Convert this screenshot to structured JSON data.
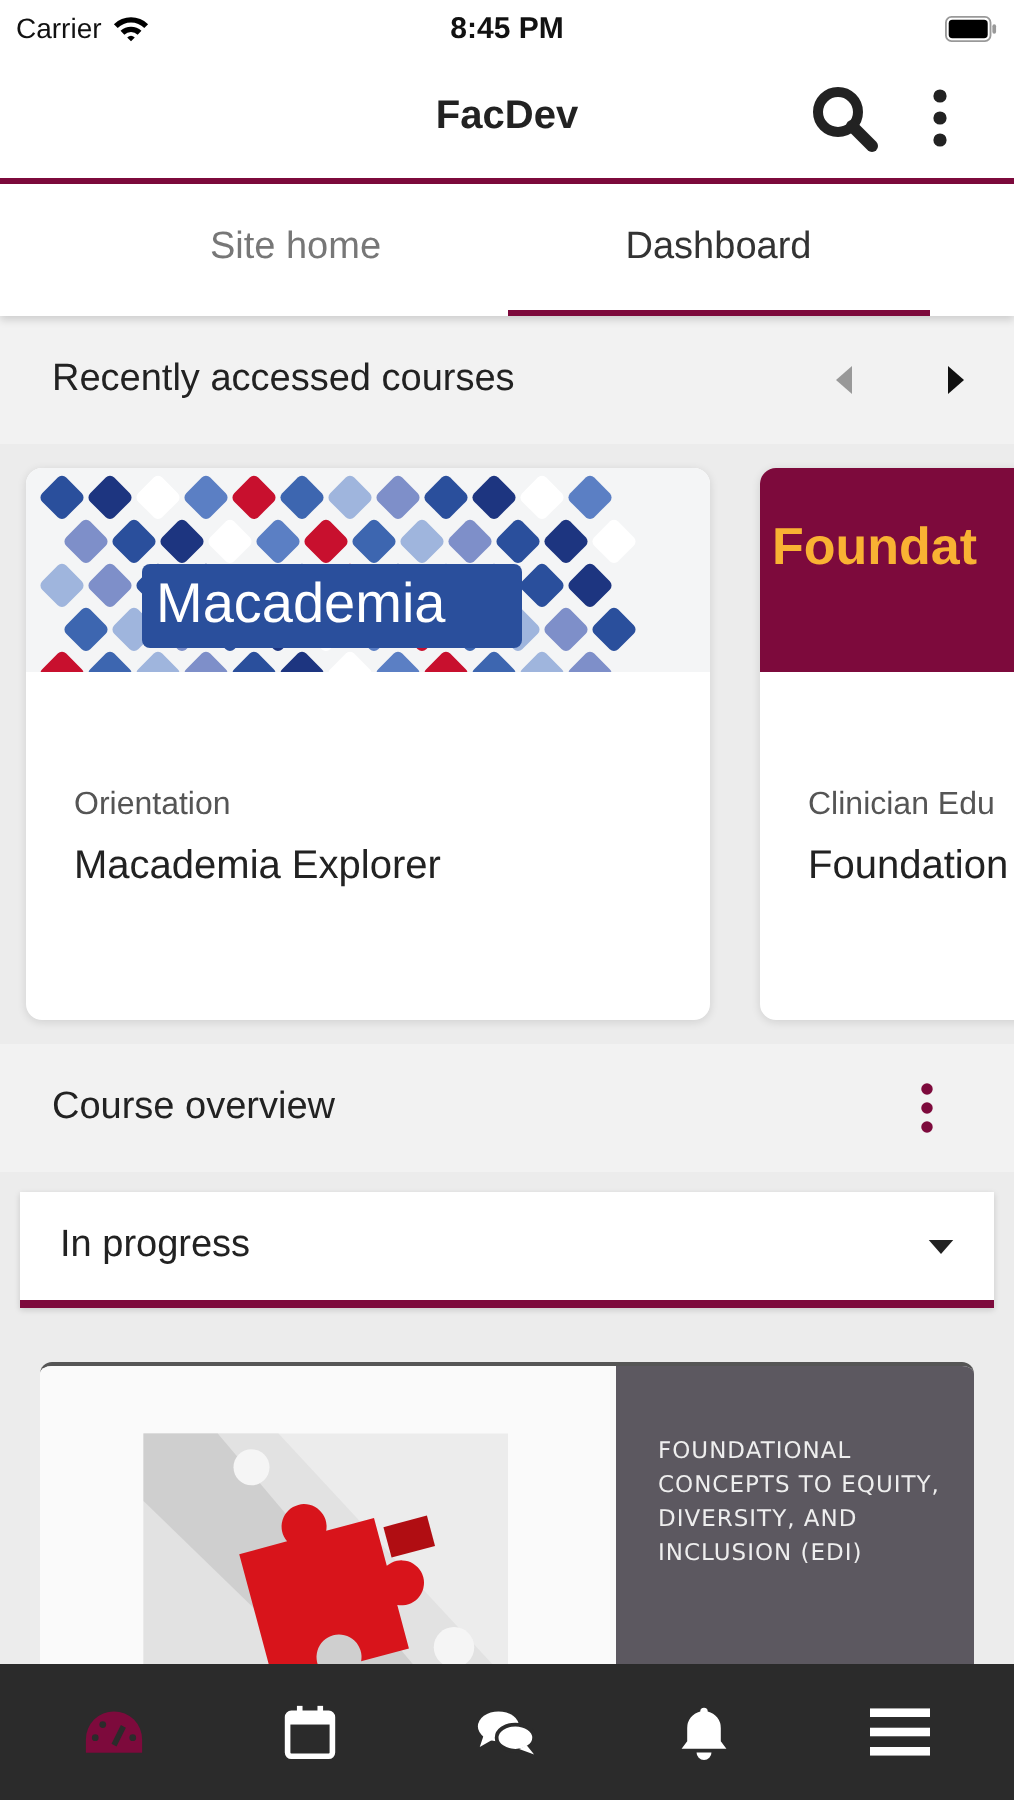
{
  "status_bar": {
    "carrier": "Carrier",
    "time": "8:45 PM"
  },
  "header": {
    "title": "FacDev"
  },
  "tabs": [
    {
      "label": "Site home",
      "selected": false
    },
    {
      "label": "Dashboard",
      "selected": true
    }
  ],
  "recent": {
    "title": "Recently accessed courses",
    "prev_disabled": true,
    "next_disabled": false,
    "courses": [
      {
        "kind": "mosaic",
        "banner_text": "Macademia",
        "category": "Orientation",
        "name": "Macademia Explorer"
      },
      {
        "kind": "solid",
        "banner_text": "Foundat",
        "category": "Clinician Edu",
        "name": "Foundation"
      }
    ]
  },
  "overview": {
    "title": "Course overview",
    "filter": "In progress",
    "courses": [
      {
        "banner_text": "FOUNDATIONAL CONCEPTS TO EQUITY, DIVERSITY, AND INCLUSION (EDI)"
      }
    ]
  },
  "bottom_nav": [
    {
      "kind": "dashboard",
      "selected": true
    },
    {
      "kind": "calendar",
      "selected": false
    },
    {
      "kind": "messages",
      "selected": false
    },
    {
      "kind": "notifications",
      "selected": false
    },
    {
      "kind": "menu",
      "selected": false
    }
  ]
}
